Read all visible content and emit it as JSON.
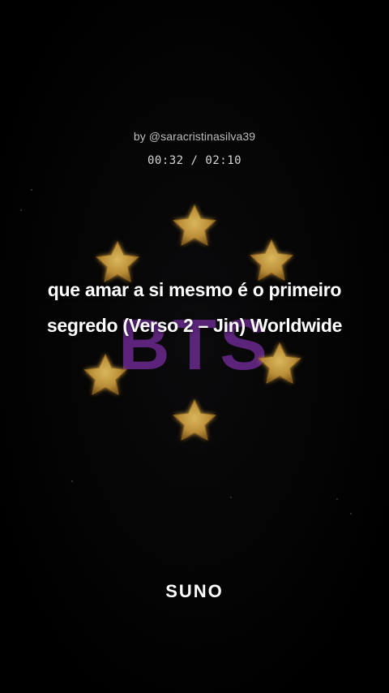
{
  "author": "by @saracristinasilva39",
  "playback": {
    "current": "00:32",
    "separator": "/",
    "duration": "02:10"
  },
  "lyrics": "que amar a si mesmo é o primeiro segredo (Verso 2 – Jin) Worldwide",
  "artwork": {
    "logo_text": "BTS",
    "logo_color": "#7a2ea0",
    "star_color": "#d9a641"
  },
  "brand": "SUNO"
}
